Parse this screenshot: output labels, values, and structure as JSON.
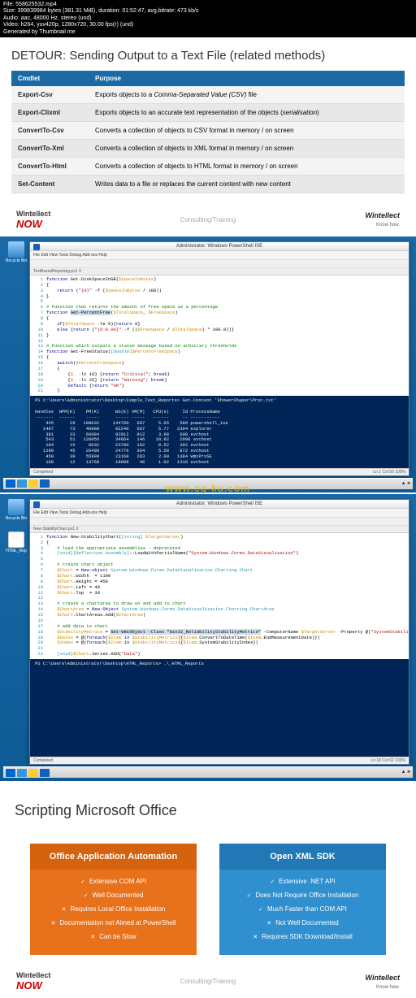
{
  "meta": {
    "file": "File: 558625532.mp4",
    "size": "Size: 399839984 bytes (381.31 MiB), duration: 01:52:47, avg.bitrate: 473 kb/s",
    "audio": "Audio: aac, 48000 Hz, stereo (und)",
    "video": "Video: h264, yuv420p, 1280x720, 30.00 fps(r) (und)",
    "gen": "Generated by Thumbnail me"
  },
  "slide1": {
    "title": "DETOUR: Sending Output to a Text File (related methods)",
    "th1": "Cmdlet",
    "th2": "Purpose",
    "rows": [
      {
        "c": "Export-Csv",
        "p_pre": "Exports objects to a ",
        "p_em": "Comma-Separated Value (CSV)",
        "p_post": " file"
      },
      {
        "c": "Export-Clixml",
        "p_pre": "Exports objects to an accurate text representation of the objects (",
        "p_em": "serialisation",
        "p_post": ")"
      },
      {
        "c": "ConvertTo-Csv",
        "p_pre": "Converts a collection of objects to CSV format in memory / on screen",
        "p_em": "",
        "p_post": ""
      },
      {
        "c": "ConvertTo-Xml",
        "p_pre": "Converts a collection of objects to XML format in memory / on screen",
        "p_em": "",
        "p_post": ""
      },
      {
        "c": "ConvertTo-Html",
        "p_pre": "Converts a collection of objects to HTML format in memory / on screen",
        "p_em": "",
        "p_post": ""
      },
      {
        "c": "Set-Content",
        "p_pre": "Writes data to a file or replaces the current content with new content",
        "p_em": "",
        "p_post": ""
      }
    ],
    "footer_mid": "Consulting/Training",
    "logo_left_1": "Wintellect",
    "logo_left_2": "NOW",
    "logo_right_1": "Wintellect",
    "logo_right_2": "Know how."
  },
  "desktop_icons": {
    "recycle": "Recycle Bin",
    "html": "HTML_Rep"
  },
  "ise1": {
    "title": "Administrator: Windows PowerShell ISE",
    "menu": "File  Edit  View  Tools  Debug  Add-ons  Help",
    "tab": "TextBasedReporting.ps1  X",
    "status_left": "Completed",
    "status_right": "Ln 1  Col 50          100%",
    "console": "PS C:\\Users\\Administrator\\Desktop\\Simple_Text_Reports> Get-Content 'ShowerShaper\\Proc.txt'\n\nHandles  NPM(K)    PM(K)      WS(K) VM(M)   CPU(s)     Id ProcessName\n-------  ------    -----      ----- -----   ------     -- -----------\n    445      29   108032     144760   687     5.05    580 powershell_ise\n   1487      73    40980      92240   507     5.77   2304 explorer\n    381      33    66084      82012   912     3.98    600 svchost\n    543      51   120956      34664   146    10.92    2996 svchost\n    184      15     8032      23780   102     0.52    392 svchost\n   1299      45    26498      24776   364     5.59    872 svchost\n    459      39    55980      23168   283     2.09   1384 WmiPrvSE\n    168      12    13768      18608    46     1.02   1316 svchost"
  },
  "watermark": "www.cg-ku.com",
  "ise2": {
    "title": "Administrator: Windows PowerShell ISE",
    "menu": "File  Edit  View  Tools  Debug  Add-ons  Help",
    "tab": "New-StabilityChart.ps1  X",
    "status_left": "Completed",
    "status_right": "Ln 18  Col 62         100%",
    "console": "PS C:\\Users\\Administrator\\Desktop\\HTML_Reports> .\\_HTML_Reports"
  },
  "slide2": {
    "title": "Scripting Microsoft Office",
    "card1": {
      "title": "Office Application Automation",
      "items": [
        {
          "t": "Extensive COM API",
          "ok": true
        },
        {
          "t": "Well Documented",
          "ok": true
        },
        {
          "t": "Requires Local Office Installation",
          "ok": false
        },
        {
          "t": "Documentation not Aimed at PowerShell",
          "ok": false
        },
        {
          "t": "Can be Slow",
          "ok": false
        }
      ]
    },
    "card2": {
      "title": "Open XML SDK",
      "items": [
        {
          "t": "Extensive .NET API",
          "ok": true
        },
        {
          "t": "Does Not Require Office Installation",
          "ok": true
        },
        {
          "t": "Much Faster than COM API",
          "ok": true
        },
        {
          "t": "Not Well Documented",
          "ok": false
        },
        {
          "t": "Requires SDK Download/Install",
          "ok": false
        }
      ]
    },
    "footer_mid": "Consulting/Training"
  }
}
